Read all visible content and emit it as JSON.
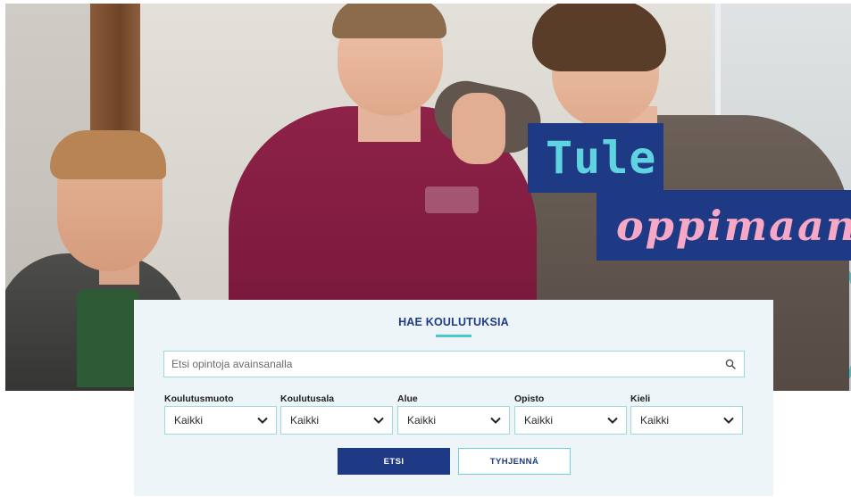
{
  "hero": {
    "slogan_line1": "Tule",
    "slogan_line2": "oppimaan",
    "slogan_bg_color": "#1f3a85",
    "slogan_line1_color": "#5fd3df",
    "slogan_line2_color": "#f6a8c6"
  },
  "search": {
    "title": "HAE KOULUTUKSIA",
    "placeholder": "Etsi opintoja avainsanalla",
    "search_icon": "search-icon",
    "filters": [
      {
        "label": "Koulutusmuoto",
        "value": "Kaikki"
      },
      {
        "label": "Koulutusala",
        "value": "Kaikki"
      },
      {
        "label": "Alue",
        "value": "Kaikki"
      },
      {
        "label": "Opisto",
        "value": "Kaikki"
      },
      {
        "label": "Kieli",
        "value": "Kaikki"
      }
    ],
    "submit_label": "ETSI",
    "clear_label": "TYHJENNÄ",
    "accent_color": "#4cc6cf",
    "primary_color": "#1f3a85"
  }
}
